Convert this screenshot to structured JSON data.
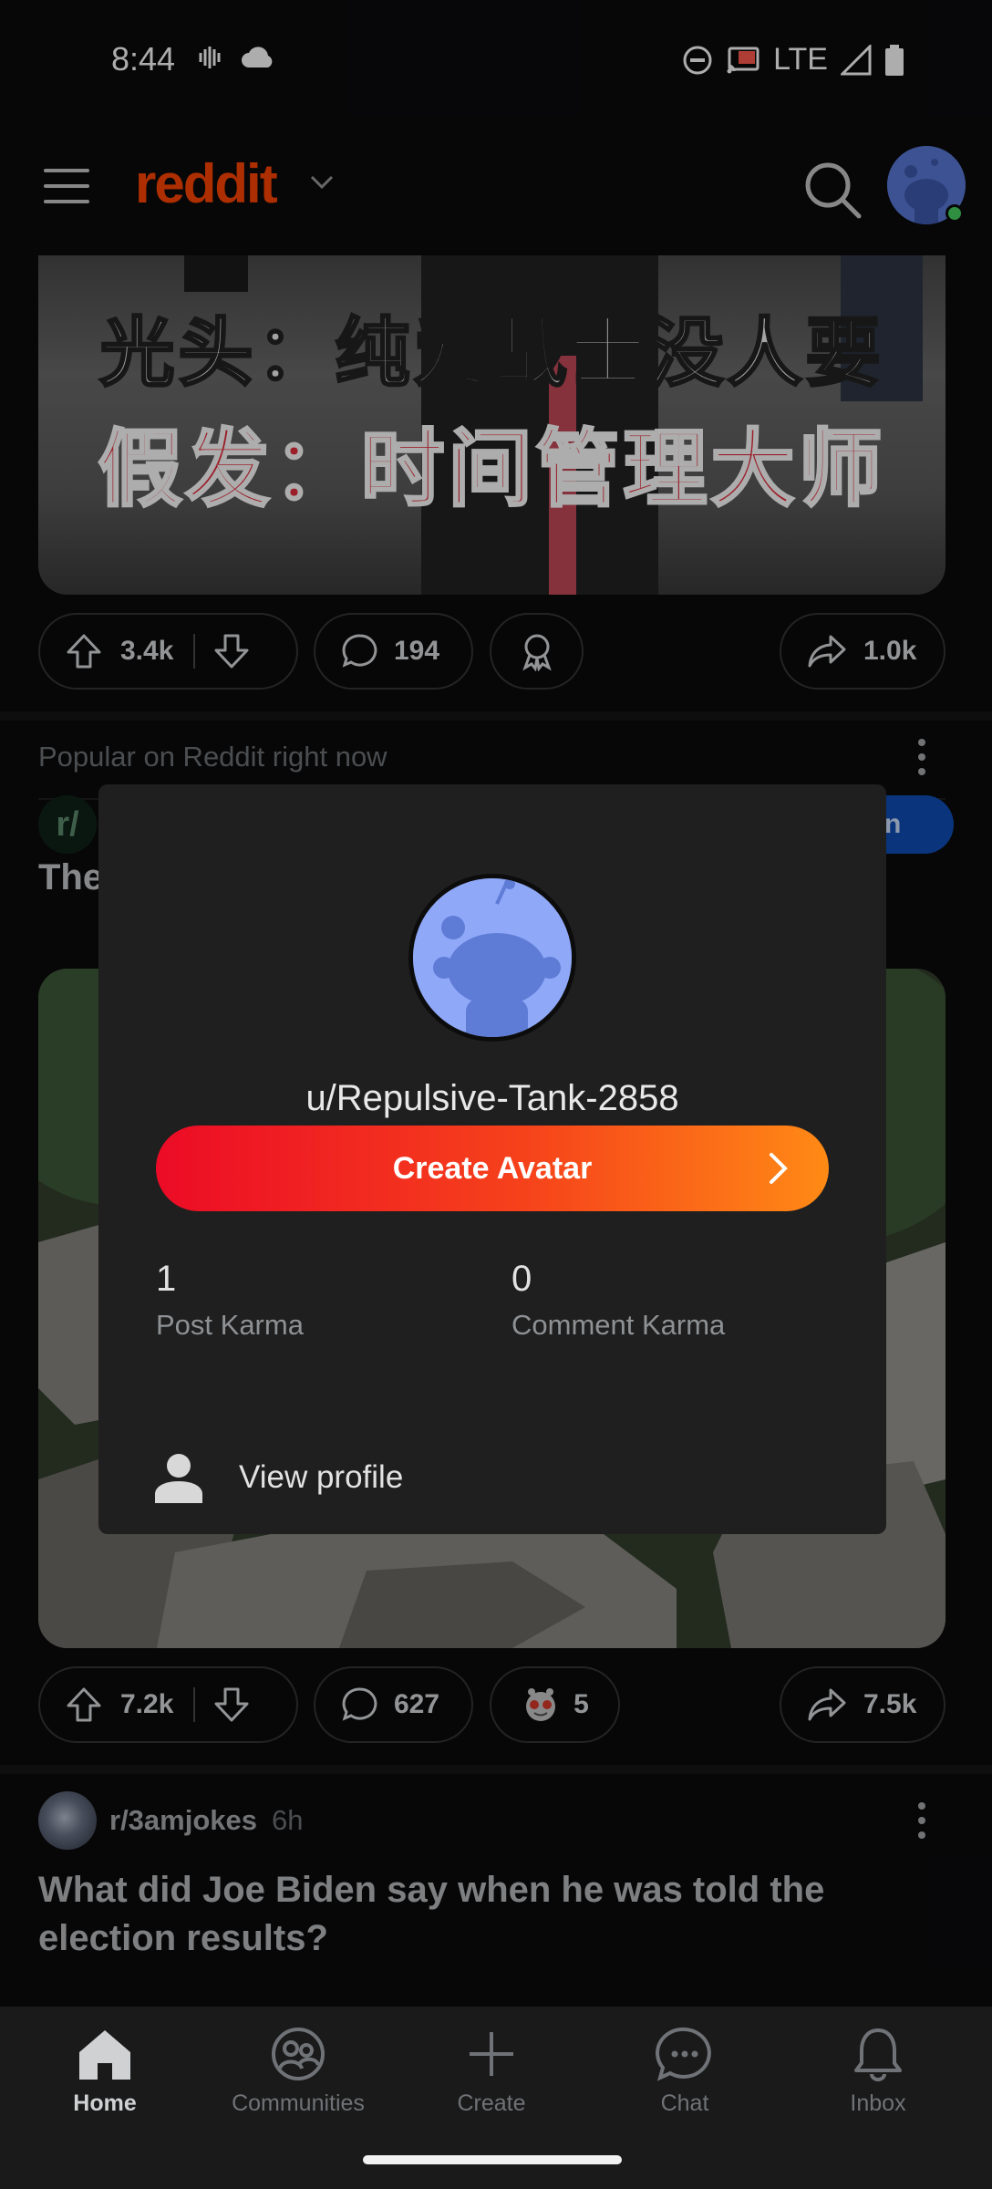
{
  "status_bar": {
    "time": "8:44",
    "network": "LTE"
  },
  "header": {
    "logo_text": "reddit",
    "accent_color": "#ff4500"
  },
  "feed": {
    "post1": {
      "caption_lines": [
        "光头：纯爱战士没人要",
        "假发：时间管理大师"
      ],
      "upvotes": "3.4k",
      "comments": "194",
      "shares": "1.0k"
    },
    "popular": {
      "label": "Popular on Reddit right now",
      "sub_prefix": "r/",
      "join_partial": "n",
      "title_partial": "The"
    },
    "post2": {
      "upvotes": "7.2k",
      "comments": "627",
      "awards": "5",
      "shares": "7.5k"
    },
    "post3": {
      "subreddit": "r/3amjokes",
      "age": "6h",
      "title": "What did Joe Biden say when he was told the election results?"
    }
  },
  "profile_popup": {
    "username": "u/Repulsive-Tank-2858",
    "create_avatar_label": "Create Avatar",
    "post_karma_value": "1",
    "post_karma_label": "Post Karma",
    "comment_karma_value": "0",
    "comment_karma_label": "Comment Karma",
    "view_profile_label": "View profile"
  },
  "bottom_nav": {
    "items": [
      {
        "label": "Home",
        "icon": "home-icon",
        "active": true
      },
      {
        "label": "Communities",
        "icon": "communities-icon"
      },
      {
        "label": "Create",
        "icon": "plus-icon"
      },
      {
        "label": "Chat",
        "icon": "chat-icon"
      },
      {
        "label": "Inbox",
        "icon": "bell-icon"
      }
    ]
  },
  "colors": {
    "background": "#0b0b0d",
    "popup_background": "#1f1f1f",
    "create_avatar_gradient_start": "#ec0b26",
    "create_avatar_gradient_end": "#ff8a15",
    "online_dot": "#46d160",
    "join_button": "#0f4fb8"
  }
}
